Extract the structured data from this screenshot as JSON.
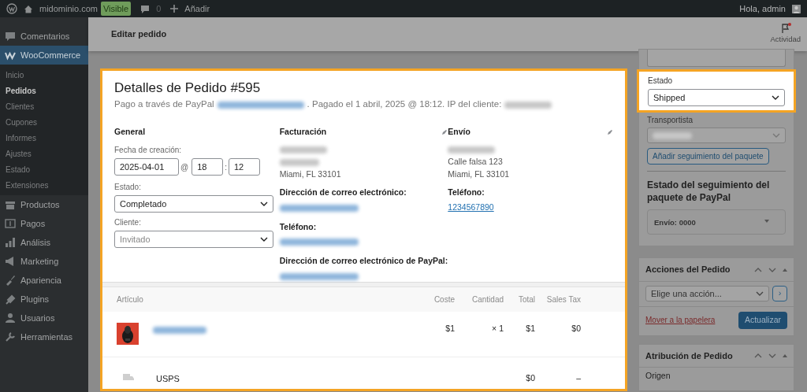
{
  "admin_bar": {
    "site": "midominio.com",
    "visibility": "Visible",
    "comments": "0",
    "add": "Añadir",
    "greeting": "Hola, admin"
  },
  "sidebar": {
    "items": [
      {
        "label": "Comentarios",
        "selected": false
      },
      {
        "label": "WooCommerce",
        "selected": true,
        "children": [
          {
            "label": "Inicio",
            "selected": false
          },
          {
            "label": "Pedidos",
            "selected": true
          },
          {
            "label": "Clientes",
            "selected": false
          },
          {
            "label": "Cupones",
            "selected": false
          },
          {
            "label": "Informes",
            "selected": false
          },
          {
            "label": "Ajustes",
            "selected": false
          },
          {
            "label": "Estado",
            "selected": false
          },
          {
            "label": "Extensiones",
            "selected": false
          }
        ]
      },
      {
        "label": "Productos",
        "selected": false
      },
      {
        "label": "Pagos",
        "selected": false
      },
      {
        "label": "Análisis",
        "selected": false
      },
      {
        "label": "Marketing",
        "selected": false
      },
      {
        "label": "Apariencia",
        "selected": false
      },
      {
        "label": "Plugins",
        "selected": false
      },
      {
        "label": "Usuarios",
        "selected": false
      },
      {
        "label": "Herramientas",
        "selected": false
      }
    ]
  },
  "header": {
    "title": "Editar pedido",
    "activity": "Actividad",
    "notification": true
  },
  "order": {
    "title": "Detalles de Pedido #595",
    "payment_line": [
      {
        "kind": "text",
        "text": "Pago a través de PayPal"
      },
      {
        "kind": "blurred_link"
      },
      {
        "kind": "text",
        "text": ". Pagado el 1 abril, 2025 @ 18:12. IP del cliente:"
      },
      {
        "kind": "blurred"
      }
    ],
    "general": {
      "heading": "General",
      "date_label": "Fecha de creación:",
      "date": "2025-04-01",
      "at": "@",
      "hour": "18",
      "colon": ":",
      "minute": "12",
      "status_label": "Estado:",
      "status": "Completado",
      "customer_label": "Cliente:",
      "customer_placeholder": "Invitado"
    },
    "billing": {
      "heading": "Facturación",
      "address": [
        {
          "kind": "blurred"
        },
        {
          "kind": "blurred"
        },
        {
          "kind": "text",
          "text": "Miami, FL 33101"
        }
      ],
      "fields": [
        {
          "label": "Dirección de correo electrónico:",
          "value": {
            "kind": "blurred_link"
          }
        },
        {
          "label": "Teléfono:",
          "value": {
            "kind": "blurred_link"
          }
        },
        {
          "label": "Dirección de correo electrónico de PayPal:",
          "value": {
            "kind": "blurred_link"
          }
        }
      ]
    },
    "shipping": {
      "heading": "Envío",
      "address": [
        {
          "kind": "blurred"
        },
        {
          "kind": "text",
          "text": "Calle falsa 123"
        },
        {
          "kind": "text",
          "text": "Miami, FL 33101"
        }
      ],
      "fields": [
        {
          "label": "Teléfono:",
          "value": {
            "kind": "link",
            "text": "1234567890"
          }
        }
      ]
    },
    "items": {
      "columns": [
        "Artículo",
        "Coste",
        "Cantidad",
        "Total",
        "Sales Tax"
      ],
      "rows": [
        {
          "kind": "product",
          "name": {
            "kind": "blurred_link"
          },
          "cost": "$1",
          "quantity": "× 1",
          "total": "$1",
          "tax": "$0"
        },
        {
          "kind": "shipping",
          "name": {
            "kind": "text",
            "text": "USPS"
          },
          "total": "$0",
          "tax": "–"
        }
      ]
    }
  },
  "tracking": {
    "status_label": "Estado",
    "status": "Shipped",
    "carrier_label": "Transportista",
    "carrier": {
      "kind": "blurred"
    },
    "add_button": "Añadir seguimiento del paquete",
    "heading": "Estado del seguimiento del paquete de PayPal",
    "shipment": "Envío: 0000"
  },
  "order_actions": {
    "title": "Acciones del Pedido",
    "select": "Elige una acción...",
    "go": "›",
    "trash": "Mover a la papelera",
    "update": "Actualizar"
  },
  "attribution": {
    "title": "Atribución de Pedido",
    "origin": "Origen"
  }
}
